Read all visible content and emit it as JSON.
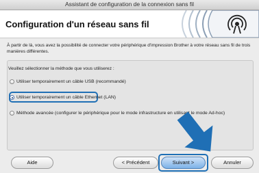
{
  "window": {
    "title": "Assistant de configuration de la connexion sans fil"
  },
  "header": {
    "title": "Configuration d'un réseau sans fil"
  },
  "description": "À partir de là, vous avez la possibilité de connecter votre périphérique d'impression Brother à votre réseau sans fil de trois manières différentes.",
  "prompt": "Veuillez sélectionner la méthode que vous utiliserez :",
  "options": [
    {
      "label": "Utiliser temporairement un câble USB (recommandé)",
      "selected": false
    },
    {
      "label": "Utiliser temporairement un câble Ethernet (LAN)",
      "selected": true
    },
    {
      "label": "Méthode avancée (configurer le périphérique pour le mode infrastructure en utilisant le mode Ad-hoc)",
      "selected": false
    }
  ],
  "buttons": {
    "help": "Aide",
    "previous": "< Précédent",
    "next": "Suivant >",
    "cancel": "Annuler"
  },
  "colors": {
    "highlight": "#1f6fb5",
    "arrow": "#1f6fb5",
    "logo_arcs": "#9fb0c2"
  }
}
